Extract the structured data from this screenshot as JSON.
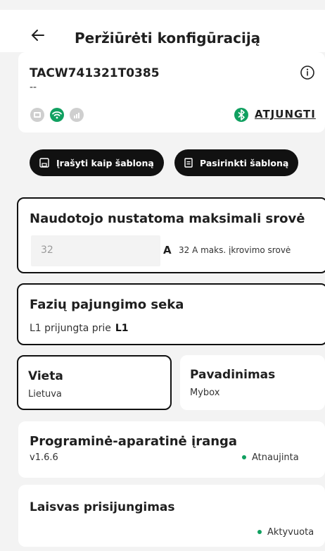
{
  "header": {
    "title": "Peržiūrėti konfigūraciją",
    "back_icon": "arrow-left-icon"
  },
  "device": {
    "serial": "TACW741321T0385",
    "subtitle": "--",
    "connectivity_icons": [
      "ethernet-icon",
      "wifi-icon",
      "cellular-4g-icon"
    ],
    "bluetooth_icon": "bluetooth-icon",
    "disconnect_label": "ATJUNGTI"
  },
  "actions": {
    "save_template": "Įrašyti kaip šabloną",
    "choose_template": "Pasirinkti šabloną"
  },
  "current": {
    "heading": "Naudotojo nustatoma maksimali srovė",
    "placeholder": "32",
    "unit": "A",
    "hint": "32 A maks. įkrovimo srovė"
  },
  "phase": {
    "heading": "Fazių pajungimo seka",
    "text": "L1 prijungta prie",
    "value": "L1"
  },
  "location": {
    "heading": "Vieta",
    "value": "Lietuva"
  },
  "name": {
    "heading": "Pavadinimas",
    "value": "Mybox"
  },
  "firmware": {
    "heading": "Programinė-aparatinė įranga",
    "version": "v1.6.6",
    "status": "Atnaujinta"
  },
  "free_access": {
    "heading": "Laisvas prisijungimas",
    "status": "Aktyvuota"
  },
  "colors": {
    "accent_green": "#10a060",
    "dark": "#111111"
  }
}
